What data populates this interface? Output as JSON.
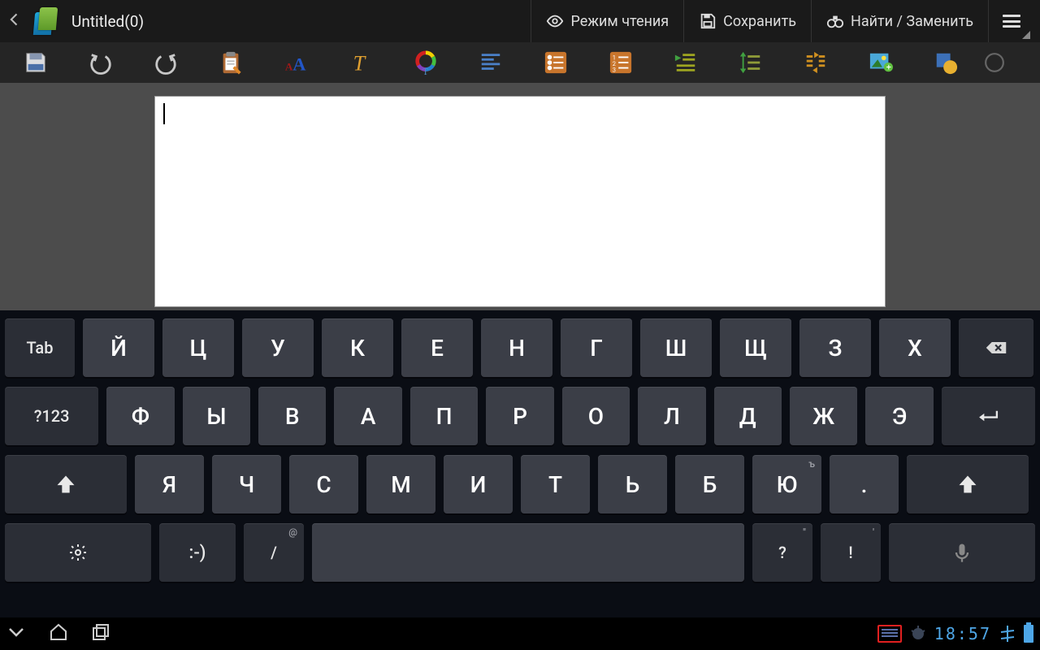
{
  "app": {
    "title": "Untitled(0)",
    "actions": {
      "read_mode": "Режим чтения",
      "save": "Сохранить",
      "find_replace": "Найти / Заменить"
    }
  },
  "toolbar": {
    "items": [
      {
        "id": "save",
        "label": "Save"
      },
      {
        "id": "undo",
        "label": "Undo"
      },
      {
        "id": "redo",
        "label": "Redo"
      },
      {
        "id": "clipboard",
        "label": "Clipboard"
      },
      {
        "id": "font",
        "label": "Font"
      },
      {
        "id": "italic",
        "label": "Style"
      },
      {
        "id": "text-color",
        "label": "Text color"
      },
      {
        "id": "align",
        "label": "Align"
      },
      {
        "id": "bullets",
        "label": "Bullets"
      },
      {
        "id": "numbering",
        "label": "Numbering"
      },
      {
        "id": "indent",
        "label": "Indent"
      },
      {
        "id": "line-spacing",
        "label": "Line spacing"
      },
      {
        "id": "column-width",
        "label": "Columns"
      },
      {
        "id": "insert-image",
        "label": "Insert image"
      },
      {
        "id": "shape",
        "label": "Shape"
      }
    ]
  },
  "keyboard": {
    "row1_special": "Tab",
    "row1": [
      "Й",
      "Ц",
      "У",
      "К",
      "Е",
      "Н",
      "Г",
      "Ш",
      "Щ",
      "З",
      "Х"
    ],
    "row2_special": "?123",
    "row2": [
      "Ф",
      "Ы",
      "В",
      "А",
      "П",
      "Р",
      "О",
      "Л",
      "Д",
      "Ж",
      "Э"
    ],
    "row3": [
      "Я",
      "Ч",
      "С",
      "М",
      "И",
      "Т",
      "Ь",
      "Б",
      "Ю",
      "."
    ],
    "row3_sup_last": "ъ",
    "row4": {
      "emoji": ":-)",
      "slash": "/",
      "slash_sup": "@",
      "question": "?",
      "question_sup": "\"",
      "exclaim": "!",
      "exclaim_sup": "'"
    }
  },
  "status": {
    "time": "18:57"
  }
}
